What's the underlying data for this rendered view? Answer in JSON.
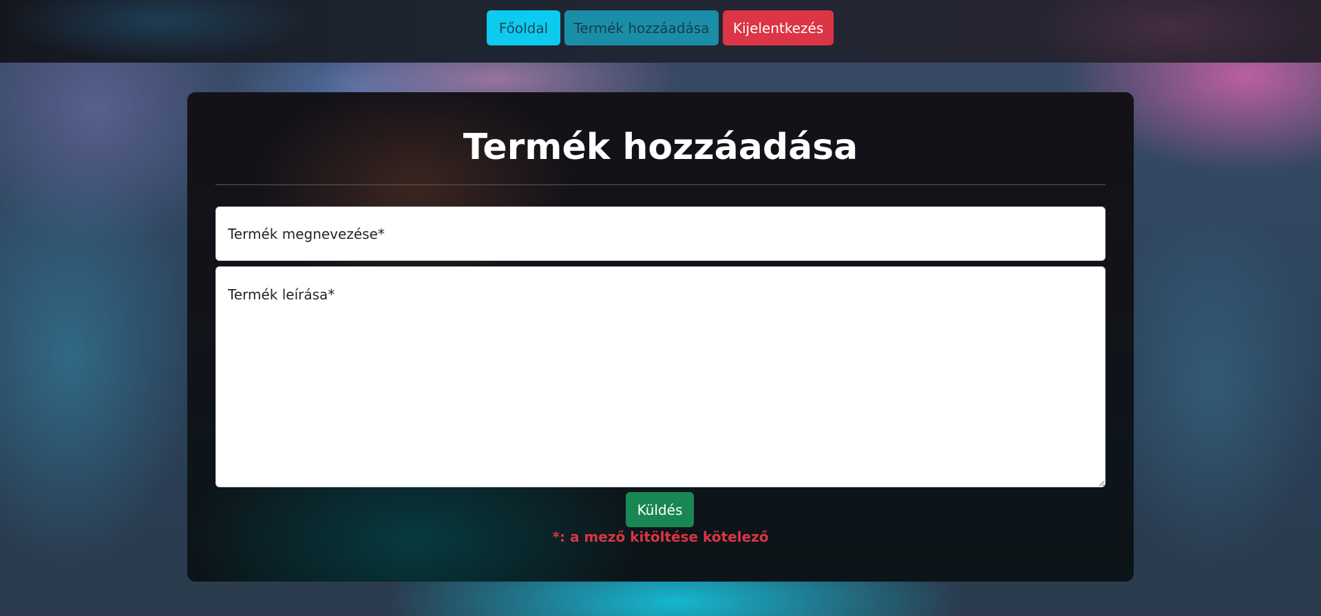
{
  "nav": {
    "home_label": "Főoldal",
    "add_product_label": "Termék hozzáadása",
    "logout_label": "Kijelentkezés"
  },
  "form": {
    "title": "Termék hozzáadása",
    "name_placeholder": "Termék megnevezése*",
    "name_value": "",
    "description_placeholder": "Termék leírása*",
    "description_value": "",
    "submit_label": "Küldés",
    "required_note": "*: a mező kitöltése kötelező"
  },
  "colors": {
    "home_button": "#0dcaf0",
    "add_button": "#1a8ea9",
    "logout_button": "#dc3545",
    "submit_button": "#198754",
    "required_note": "#dc3545"
  }
}
